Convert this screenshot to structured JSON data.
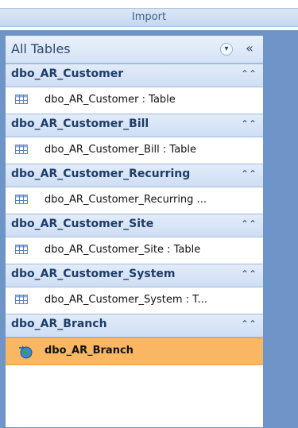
{
  "ribbon": {
    "group_label": "Import"
  },
  "nav": {
    "header_title": "All Tables",
    "menu_icon": "chevron-down-circle-icon",
    "collapse_icon": "double-chevron-left-icon",
    "groups": [
      {
        "title": "dbo_AR_Customer",
        "item": "dbo_AR_Customer : Table",
        "icon": "table-icon"
      },
      {
        "title": "dbo_AR_Customer_Bill",
        "item": "dbo_AR_Customer_Bill : Table",
        "icon": "table-icon"
      },
      {
        "title": "dbo_AR_Customer_Recurring",
        "item": "dbo_AR_Customer_Recurring ...",
        "icon": "table-icon"
      },
      {
        "title": "dbo_AR_Customer_Site",
        "item": "dbo_AR_Customer_Site : Table",
        "icon": "table-icon"
      },
      {
        "title": "dbo_AR_Customer_System",
        "item": "dbo_AR_Customer_System : T...",
        "icon": "table-icon"
      },
      {
        "title": "dbo_AR_Branch",
        "item": "dbo_AR_Branch",
        "icon": "linked-globe-icon"
      }
    ]
  },
  "colors": {
    "frame": "#6f94c8",
    "selected": "#f9b763",
    "header_text": "#1e3d6a"
  }
}
